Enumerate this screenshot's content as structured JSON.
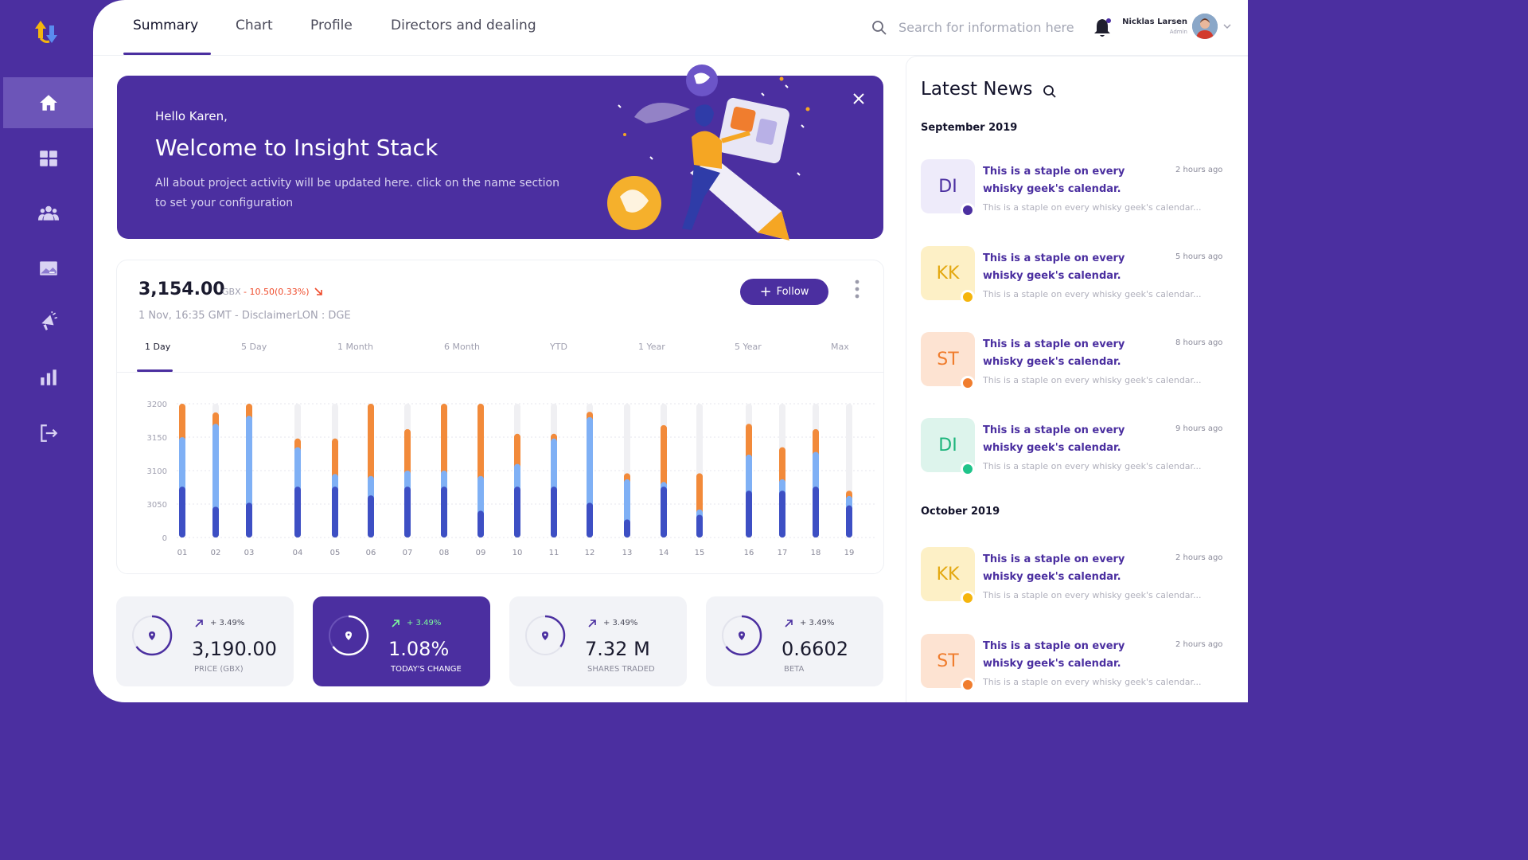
{
  "nav": {
    "items": [
      {
        "icon": "home-icon"
      },
      {
        "icon": "dashboard-icon"
      },
      {
        "icon": "users-icon"
      },
      {
        "icon": "image-icon"
      },
      {
        "icon": "megaphone-icon"
      },
      {
        "icon": "bar-chart-icon"
      },
      {
        "icon": "logout-icon"
      }
    ]
  },
  "header": {
    "tabs": [
      {
        "label": "Summary"
      },
      {
        "label": "Chart"
      },
      {
        "label": "Profile"
      },
      {
        "label": "Directors and dealing"
      }
    ],
    "search_placeholder": "Search for information here",
    "user_name": "Nicklas Larsen",
    "user_role": "Admin"
  },
  "banner": {
    "greeting": "Hello Karen,",
    "title": "Welcome to Insight Stack",
    "description": "All about project activity will be updated here. click on the name section to set your configuration"
  },
  "quote": {
    "price": "3,154.00",
    "currency": "GBX",
    "change": "- 10.50(0.33%)",
    "date": "1 Nov, 16:35 GMT - Disclaimer",
    "exchange": "LON : DGE",
    "follow_label": "Follow",
    "ranges": [
      "1 Day",
      "5 Day",
      "1 Month",
      "6 Month",
      "YTD",
      "1 Year",
      "5 Year",
      "Max"
    ]
  },
  "chart_data": {
    "type": "bar",
    "categories": [
      "01",
      "02",
      "03",
      "04",
      "05",
      "06",
      "07",
      "08",
      "09",
      "10",
      "11",
      "12",
      "13",
      "14",
      "15",
      "16",
      "17",
      "18",
      "19"
    ],
    "y_tick_labels": [
      "3200",
      "3150",
      "3100",
      "3050",
      "0"
    ],
    "colors": {
      "dark": "#3d4fc4",
      "light": "#7fb0f5",
      "orange": "#f28a3a",
      "track": "#f0f0f3"
    },
    "series": [
      {
        "values_dark_top": [
          3076,
          3046,
          3052,
          3076,
          3076,
          3063,
          3076,
          3076,
          3040,
          3076,
          3076,
          3052,
          3027,
          3076,
          3034,
          3070,
          3070,
          3076,
          3048
        ]
      },
      {
        "values_light_top": [
          3150,
          3170,
          3182,
          3135,
          3095,
          3092,
          3100,
          3100,
          3092,
          3110,
          3148,
          3180,
          3087,
          3083,
          3042,
          3124,
          3087,
          3128,
          3062
        ]
      },
      {
        "values_orange_top": [
          3200,
          3187,
          3200,
          3148,
          3148,
          3200,
          3162,
          3200,
          3200,
          3155,
          3155,
          3188,
          3096,
          3168,
          3096,
          3170,
          3135,
          3162,
          3070
        ]
      }
    ],
    "ylim": [
      3000,
      3200
    ],
    "grid": true
  },
  "stats": [
    {
      "delta": "+ 3.49%",
      "value": "3,190.00",
      "label": "PRICE (GBX)",
      "progress": 0.65
    },
    {
      "delta": "+ 3.49%",
      "value": "1.08%",
      "label": "TODAY'S CHANGE",
      "progress": 0.65
    },
    {
      "delta": "+ 3.49%",
      "value": "7.32 M",
      "label": "SHARES TRADED",
      "progress": 0.35
    },
    {
      "delta": "+ 3.49%",
      "value": "0.6602",
      "label": "BETA",
      "progress": 0.65
    }
  ],
  "news": {
    "title": "Latest News",
    "months": [
      "September 2019",
      "October 2019"
    ],
    "items": [
      {
        "initials": "DI",
        "headline": "This is a staple on every whisky geek's calendar.",
        "time": "2 hours ago",
        "snippet": "This is a staple on every whisky geek's calendar...",
        "bg": "#eeebfa",
        "fg": "#4b2fa0",
        "dot": "#4b2fa0"
      },
      {
        "initials": "KK",
        "headline": "This is a staple on every whisky geek's calendar.",
        "time": "5 hours ago",
        "snippet": "This is a staple on every whisky geek's calendar...",
        "bg": "#fdf0c6",
        "fg": "#e3a811",
        "dot": "#f5b50d"
      },
      {
        "initials": "ST",
        "headline": "This is a staple on every whisky geek's calendar.",
        "time": "8 hours ago",
        "snippet": "This is a staple on every whisky geek's calendar...",
        "bg": "#fde3d2",
        "fg": "#f07d2e",
        "dot": "#f07d2e"
      },
      {
        "initials": "DI",
        "headline": "This is a staple on every whisky geek's calendar.",
        "time": "9 hours ago",
        "snippet": "This is a staple on every whisky geek's calendar...",
        "bg": "#ddf4ec",
        "fg": "#1db57c",
        "dot": "#1fc48a"
      },
      {
        "initials": "KK",
        "headline": "This is a staple on every whisky geek's calendar.",
        "time": "2 hours ago",
        "snippet": "This is a staple on every whisky geek's calendar...",
        "bg": "#fdf0c6",
        "fg": "#e3a811",
        "dot": "#f5b50d"
      },
      {
        "initials": "ST",
        "headline": "This is a staple on every whisky geek's calendar.",
        "time": "2 hours ago",
        "snippet": "This is a staple on every whisky geek's calendar...",
        "bg": "#fde3d2",
        "fg": "#f07d2e",
        "dot": "#f07d2e"
      }
    ]
  }
}
